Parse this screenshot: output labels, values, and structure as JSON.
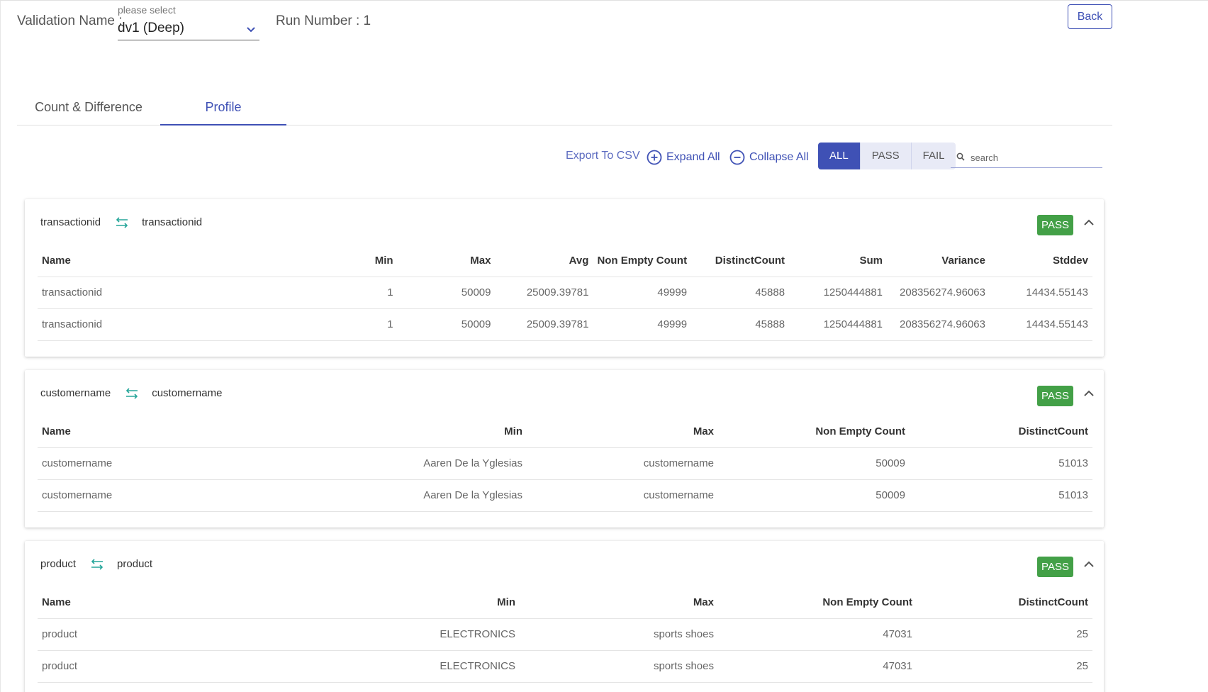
{
  "header": {
    "validation_label": "Validation Name :",
    "select_placeholder": "please select",
    "select_value": "dv1 (Deep)",
    "run_label": "Run Number : 1",
    "back_label": "Back"
  },
  "tabs": [
    {
      "label": "Count & Difference",
      "active": false
    },
    {
      "label": "Profile",
      "active": true
    }
  ],
  "toolbar": {
    "export_label": "Export To CSV",
    "expand_label": "Expand All",
    "collapse_label": "Collapse All",
    "filters": [
      "ALL",
      "PASS",
      "FAIL"
    ],
    "active_filter": "ALL",
    "search_placeholder": "search"
  },
  "colors": {
    "accent": "#3f51b5",
    "pass": "#43a047",
    "swap_icon": "#26a69a"
  },
  "cards": [
    {
      "source": "transactionid",
      "target": "transactionid",
      "status": "PASS",
      "columns": [
        "Name",
        "Min",
        "Max",
        "Avg",
        "Non Empty Count",
        "DistinctCount",
        "Sum",
        "Variance",
        "Stddev"
      ],
      "rows": [
        [
          "transactionid",
          "1",
          "50009",
          "25009.39781",
          "49999",
          "45888",
          "1250444881",
          "208356274.96063",
          "14434.55143"
        ],
        [
          "transactionid",
          "1",
          "50009",
          "25009.39781",
          "49999",
          "45888",
          "1250444881",
          "208356274.96063",
          "14434.55143"
        ]
      ]
    },
    {
      "source": "customername",
      "target": "customername",
      "status": "PASS",
      "columns": [
        "Name",
        "Min",
        "Max",
        "Non Empty Count",
        "DistinctCount"
      ],
      "rows": [
        [
          "customername",
          "Aaren De la Yglesias",
          "customername",
          "50009",
          "51013"
        ],
        [
          "customername",
          "Aaren De la Yglesias",
          "customername",
          "50009",
          "51013"
        ]
      ]
    },
    {
      "source": "product",
      "target": "product",
      "status": "PASS",
      "columns": [
        "Name",
        "Min",
        "Max",
        "Non Empty Count",
        "DistinctCount"
      ],
      "rows": [
        [
          "product",
          "ELECTRONICS",
          "sports shoes",
          "47031",
          "25"
        ],
        [
          "product",
          "ELECTRONICS",
          "sports shoes",
          "47031",
          "25"
        ]
      ]
    }
  ]
}
